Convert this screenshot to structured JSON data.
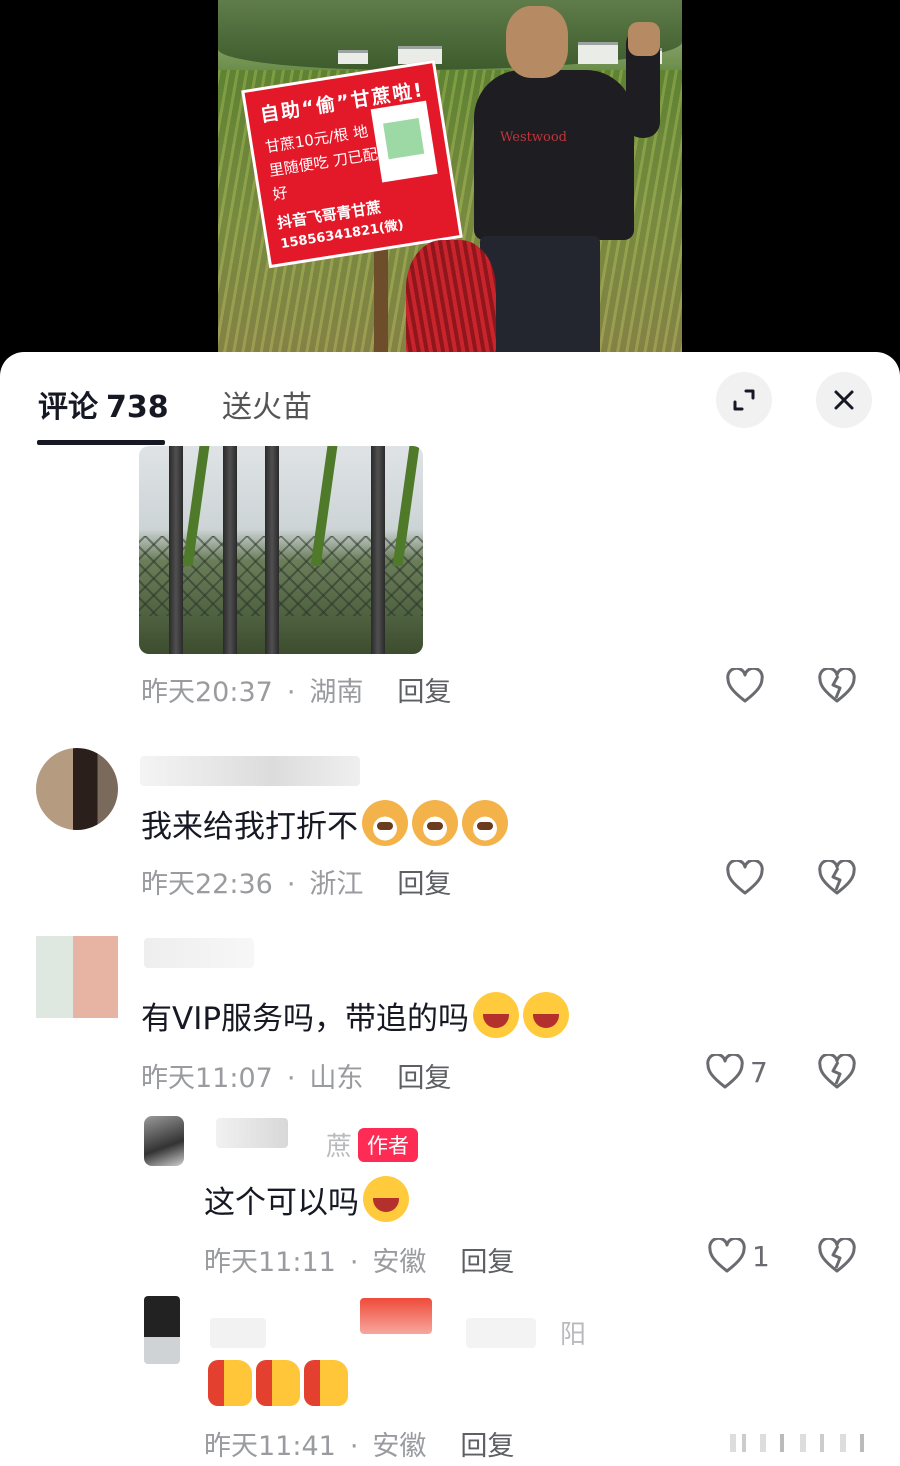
{
  "tabs": {
    "comments_label": "评论",
    "comments_count": "738",
    "gift_label": "送火苗"
  },
  "video": {
    "sign_line1": "自助“偷”甘蔗啦!",
    "sign_line2": "甘蔗10元/根 地里随便吃 刀已配好",
    "sign_line3": "抖音飞哥青甘蔗",
    "sign_line4": "15856341821(微)"
  },
  "comments": [
    {
      "time": "昨天20:37",
      "location": "湖南",
      "reply_label": "回复"
    },
    {
      "text": "我来给我打折不",
      "emojis": [
        "doge-emoji",
        "doge-emoji",
        "doge-emoji"
      ],
      "time": "昨天22:36",
      "location": "浙江",
      "reply_label": "回复"
    },
    {
      "text": "有VIP服务吗，带追的吗",
      "emojis": [
        "laugh-cry-emoji",
        "laugh-cry-emoji"
      ],
      "time": "昨天11:07",
      "location": "山东",
      "reply_label": "回复",
      "likes": "7"
    }
  ],
  "replies": [
    {
      "author_badge": "作者",
      "name_tail": "蔗",
      "text": "这个可以吗",
      "emojis": [
        "rofl-emoji"
      ],
      "time": "昨天11:11",
      "location": "安徽",
      "reply_label": "回复",
      "likes": "1"
    },
    {
      "name_tail": "阳",
      "emojis": [
        "thumbs-up-emoji",
        "thumbs-up-emoji",
        "thumbs-up-emoji"
      ],
      "time": "昨天11:41",
      "location": "安徽",
      "reply_label": "回复"
    }
  ],
  "colors": {
    "accent": "#fe2c55",
    "text_primary": "#161823",
    "text_meta": "#9a9b9f",
    "sign_red": "#e3192a"
  }
}
